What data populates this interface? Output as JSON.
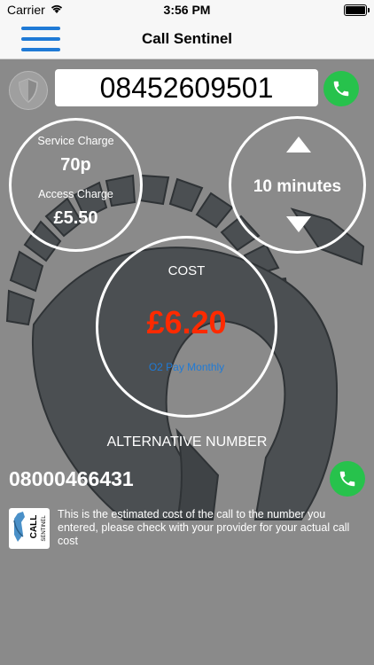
{
  "status_bar": {
    "carrier": "Carrier",
    "time": "3:56 PM"
  },
  "nav": {
    "title": "Call Sentinel"
  },
  "phone_number": "08452609501",
  "charges": {
    "service_label": "Service Charge",
    "service_value": "70p",
    "access_label": "Access Charge",
    "access_value": "£5.50"
  },
  "duration": {
    "value": "10 minutes"
  },
  "cost": {
    "label": "COST",
    "value": "£6.20",
    "plan": "O2 Pay Monthly"
  },
  "alternative": {
    "label": "ALTERNATIVE NUMBER",
    "number": "08000466431"
  },
  "disclaimer": "This is the estimated cost of the call to the number you entered, please check with your provider for your actual call cost",
  "logo": {
    "text_top": "CALL",
    "text_bottom": "SENTINEL"
  },
  "colors": {
    "background": "#8a8a8a",
    "call_green": "#27c24c",
    "cost_red": "#ff2a00",
    "plan_blue": "#1f7ad6",
    "menu_blue": "#1f7ad6"
  },
  "icons": [
    "menu-icon",
    "shield-icon",
    "phone-icon",
    "arrow-up-icon",
    "arrow-down-icon",
    "helmet-logo"
  ]
}
